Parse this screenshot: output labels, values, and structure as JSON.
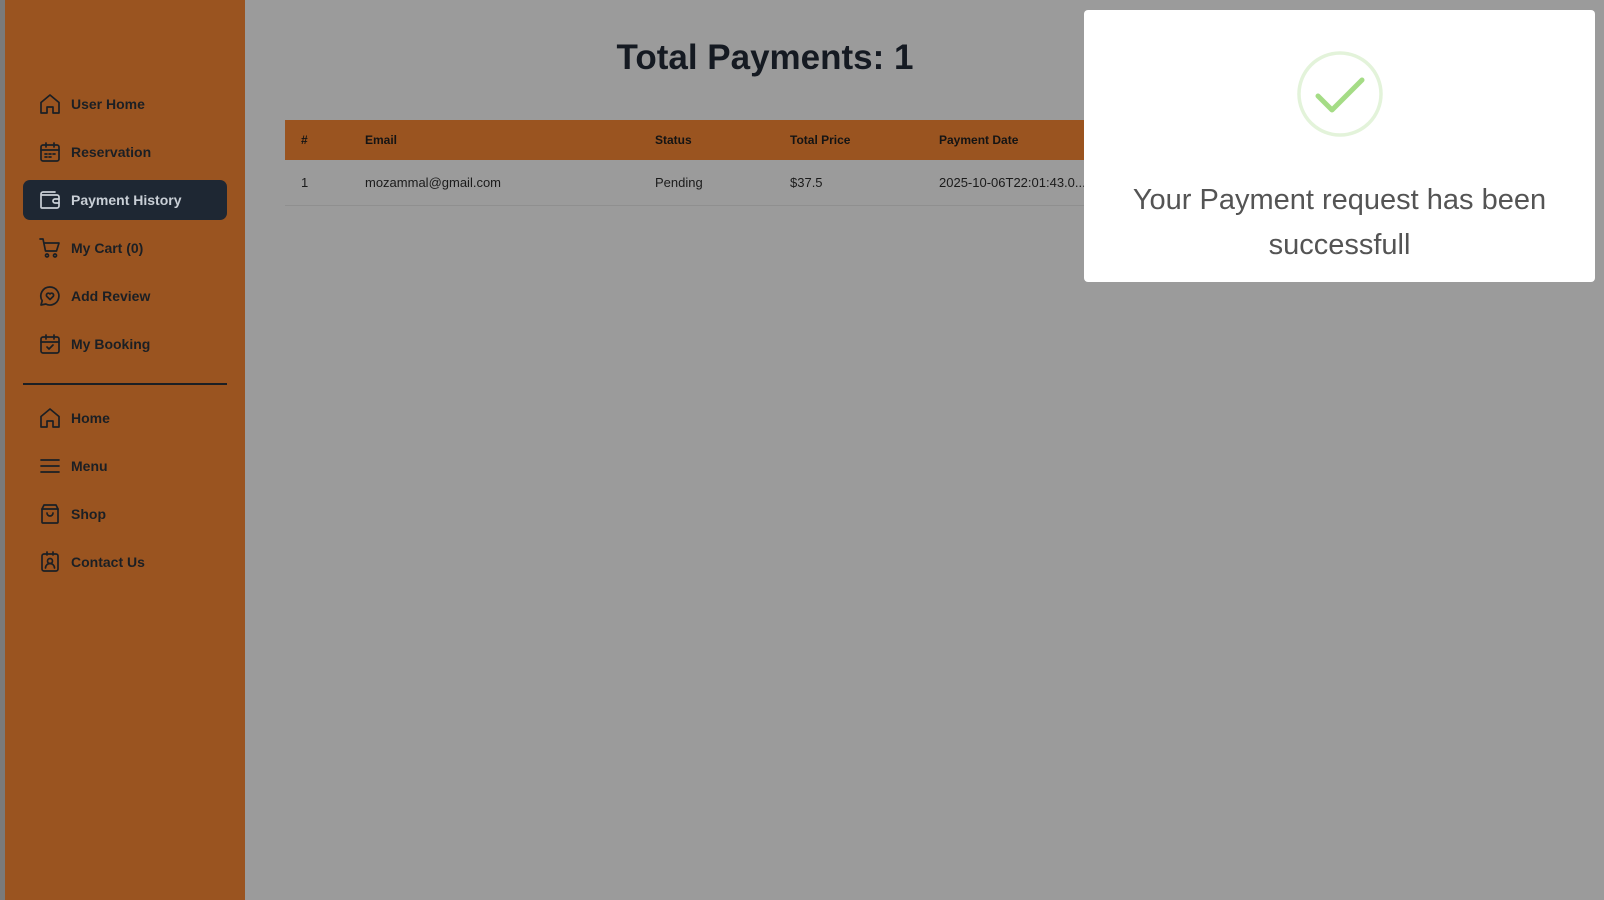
{
  "sidebar": {
    "dashboard_items": [
      {
        "label": "User Home",
        "icon": "home-icon",
        "active": false
      },
      {
        "label": "Reservation",
        "icon": "calendar-icon",
        "active": false
      },
      {
        "label": "Payment History",
        "icon": "wallet-icon",
        "active": true
      },
      {
        "label": "My Cart (0)",
        "icon": "cart-icon",
        "active": false
      },
      {
        "label": "Add Review",
        "icon": "review-icon",
        "active": false
      },
      {
        "label": "My Booking",
        "icon": "calendar-check-icon",
        "active": false
      }
    ],
    "site_items": [
      {
        "label": "Home",
        "icon": "home-icon"
      },
      {
        "label": "Menu",
        "icon": "menu-icon"
      },
      {
        "label": "Shop",
        "icon": "shopping-bag-icon"
      },
      {
        "label": "Contact Us",
        "icon": "contact-icon"
      }
    ]
  },
  "main": {
    "title": "Total Payments: 1",
    "table": {
      "columns": [
        "#",
        "Email",
        "Status",
        "Total Price",
        "Payment Date"
      ],
      "rows": [
        [
          "1",
          "mozammal@gmail.com",
          "Pending",
          "$37.5",
          "2025-10-06T22:01:43.0..."
        ]
      ]
    }
  },
  "modal": {
    "icon": "success-check-icon",
    "message": "Your Payment request has been successfull"
  },
  "colors": {
    "sidebar": "#9a5420",
    "active_item": "#1e2733",
    "overlay": "#9b9b9b",
    "success": "#a5dc86"
  }
}
